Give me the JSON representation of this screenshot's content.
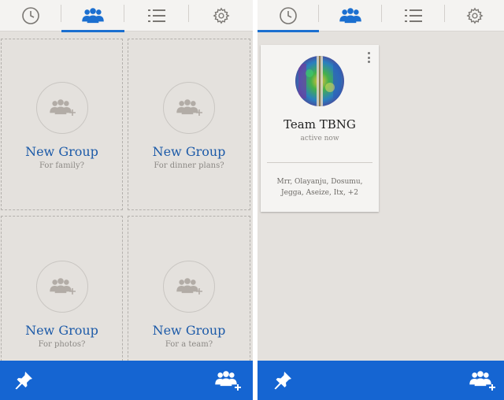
{
  "left_screen": {
    "tabs": [
      {
        "icon": "clock-icon",
        "active": false
      },
      {
        "icon": "group-icon",
        "active": true
      },
      {
        "icon": "list-icon",
        "active": false
      },
      {
        "icon": "gear-icon",
        "active": false
      }
    ],
    "groups": [
      {
        "title": "New Group",
        "subtitle": "For family?"
      },
      {
        "title": "New Group",
        "subtitle": "For dinner plans?"
      },
      {
        "title": "New Group",
        "subtitle": "For photos?"
      },
      {
        "title": "New Group",
        "subtitle": "For a team?"
      }
    ],
    "bottom_bar": {
      "left_icon": "pin-icon",
      "right_icon": "add-group-icon"
    }
  },
  "right_screen": {
    "tabs": [
      {
        "icon": "clock-icon",
        "active": true
      },
      {
        "icon": "group-icon",
        "active": false
      },
      {
        "icon": "list-icon",
        "active": false
      },
      {
        "icon": "gear-icon",
        "active": false
      }
    ],
    "group_card": {
      "name": "Team TBNG",
      "status": "active now",
      "members_line1": "Mrr, Olayanju, Dosumu,",
      "members_line2": "Jegga, Aseize, Itx, +2"
    },
    "bottom_bar": {
      "left_icon": "pin-icon",
      "right_icon": "add-group-icon"
    }
  },
  "colors": {
    "accent": "#1565d2",
    "background": "#e4e1dd",
    "tabbar": "#f4f3f1",
    "link_text": "#1c5aa8",
    "muted_text": "#8c8985"
  }
}
